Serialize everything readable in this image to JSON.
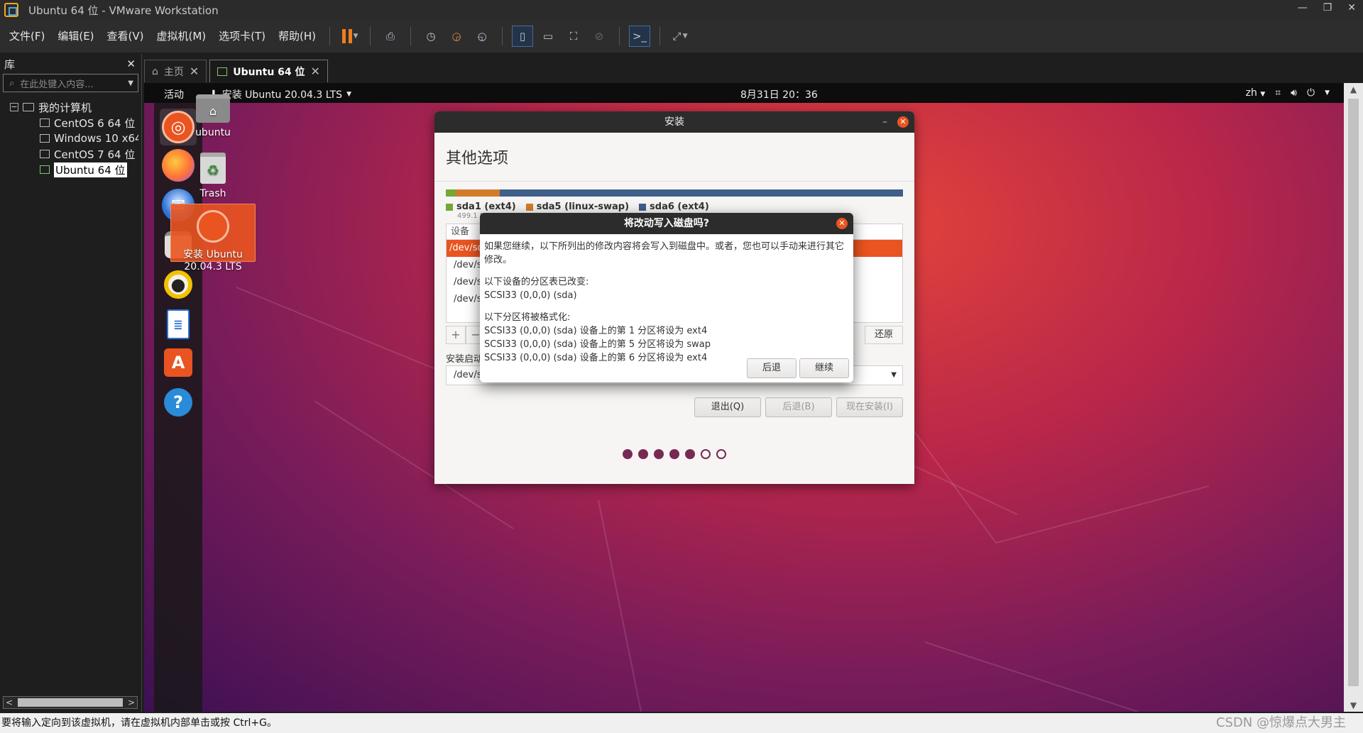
{
  "window": {
    "title": "Ubuntu 64 位 - VMware Workstation"
  },
  "menu": [
    "文件(F)",
    "编辑(E)",
    "查看(V)",
    "虚拟机(M)",
    "选项卡(T)",
    "帮助(H)"
  ],
  "library": {
    "title": "库",
    "search_placeholder": "在此处键入内容...",
    "root": "我的计算机",
    "vms": [
      "CentOS 6 64 位",
      "Windows 10 x64",
      "CentOS 7 64 位",
      "Ubuntu 64 位"
    ]
  },
  "tabs": [
    {
      "label": "主页"
    },
    {
      "label": "Ubuntu 64 位"
    }
  ],
  "gnome": {
    "activities": "活动",
    "app": "安装 Ubuntu 20.04.3 LTS",
    "clock": "8月31日  20：36",
    "lang": "zh"
  },
  "desktop": {
    "home_label": "ubuntu",
    "trash_label": "Trash",
    "installer_label_1": "安装 Ubuntu",
    "installer_label_2": "20.04.3 LTS"
  },
  "installer": {
    "window_title": "安装",
    "heading": "其他选项",
    "legend": [
      {
        "label": "sda1 (ext4)",
        "color": "#73a835"
      },
      {
        "label": "sda5 (linux-swap)",
        "color": "#d47b2a"
      },
      {
        "label": "sda6 (ext4)",
        "color": "#3e5f8a"
      }
    ],
    "legend_sub": "499.1 MB",
    "table_header": "设备",
    "rows": [
      "/dev/sda",
      "/dev/sda",
      "/dev/sda",
      "/dev/sda"
    ],
    "revert": "还原",
    "boot_label": "安装启动引",
    "boot_value": "/dev/sda",
    "quit": "退出(Q)",
    "back": "后退(B)",
    "install_now": "现在安装(I)",
    "progress": {
      "total_steps": 7,
      "current_step": 5
    }
  },
  "dialog": {
    "title": "将改动写入磁盘吗?",
    "intro": "如果您继续，以下所列出的修改内容将会写入到磁盘中。或者，您也可以手动来进行其它修改。",
    "table_changed_title": "以下设备的分区表已改变:",
    "table_changed_item": "SCSI33 (0,0,0) (sda)",
    "format_title": "以下分区将被格式化:",
    "format_items": [
      "SCSI33 (0,0,0) (sda) 设备上的第 1 分区将设为 ext4",
      "SCSI33 (0,0,0) (sda) 设备上的第 5 分区将设为 swap",
      "SCSI33 (0,0,0) (sda) 设备上的第 6 分区将设为 ext4"
    ],
    "back_btn": "后退",
    "continue_btn": "继续"
  },
  "statusbar": {
    "text": "要将输入定向到该虚拟机，请在虚拟机内部单击或按 Ctrl+G。",
    "watermark": "CSDN @惊爆点大男主"
  },
  "colors": {
    "ubuntu_orange": "#e95420",
    "aubergine": "#772953"
  }
}
